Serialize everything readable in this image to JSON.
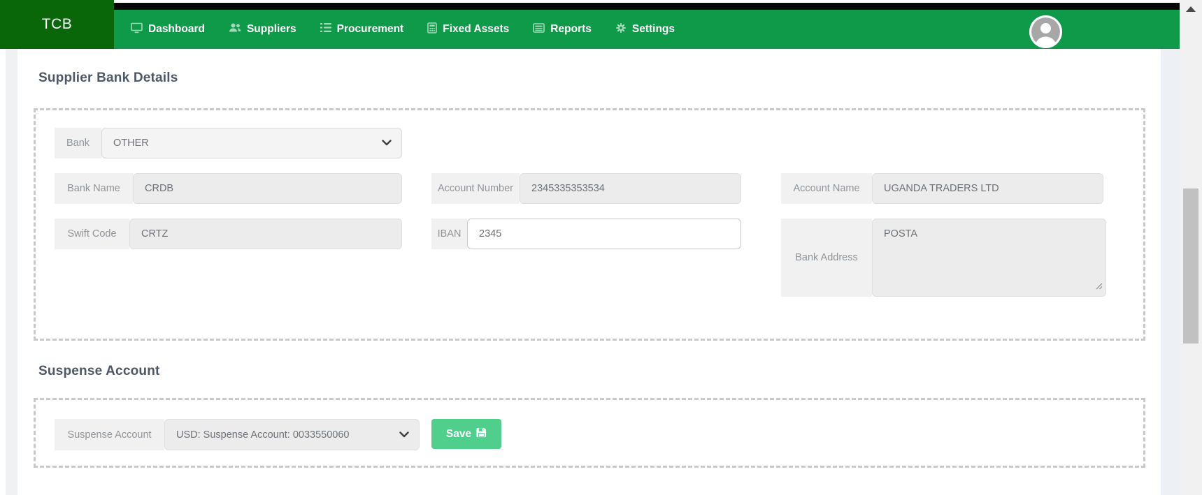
{
  "navbar": {
    "brand": "TCB",
    "items": [
      {
        "label": "Dashboard",
        "icon": "dashboard-icon"
      },
      {
        "label": "Suppliers",
        "icon": "suppliers-icon"
      },
      {
        "label": "Procurement",
        "icon": "procurement-icon"
      },
      {
        "label": "Fixed Assets",
        "icon": "fixed-assets-icon"
      },
      {
        "label": "Reports",
        "icon": "reports-icon"
      },
      {
        "label": "Settings",
        "icon": "settings-icon"
      }
    ],
    "avatar_icon": "user-avatar-icon"
  },
  "supplier_bank_details": {
    "title": "Supplier Bank Details",
    "fields": {
      "bank": {
        "label": "Bank",
        "value": "OTHER"
      },
      "bank_name": {
        "label": "Bank Name",
        "value": "CRDB"
      },
      "account_number": {
        "label": "Account Number",
        "value": "2345335353534"
      },
      "account_name": {
        "label": "Account Name",
        "value": "UGANDA TRADERS LTD"
      },
      "swift_code": {
        "label": "Swift Code",
        "value": "CRTZ"
      },
      "iban": {
        "label": "IBAN",
        "value": "2345"
      },
      "bank_address": {
        "label": "Bank Address",
        "value": "POSTA"
      }
    }
  },
  "suspense_account": {
    "title": "Suspense Account",
    "field": {
      "label": "Suspense Account",
      "value": "USD: Suspense Account: 0033550060"
    },
    "save_button": {
      "label": "Save",
      "icon": "floppy-disk-icon"
    }
  },
  "colors": {
    "navbar_green": "#0e9a48",
    "brand_dark_green": "#096609",
    "save_button_green": "#4fce8c"
  }
}
